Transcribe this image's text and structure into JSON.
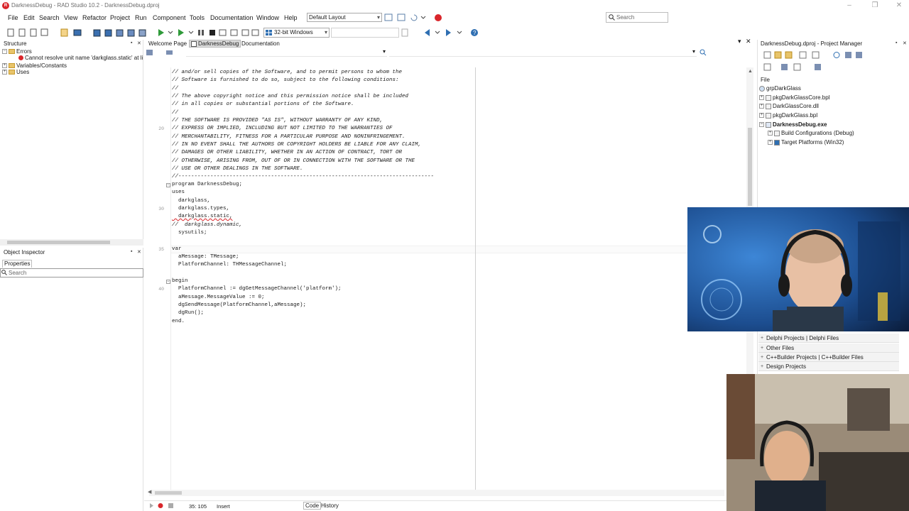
{
  "window": {
    "title": "DarknessDebug - RAD Studio 10.2 - DarknessDebug.dproj",
    "app_icon": "rad-studio-icon"
  },
  "menu": [
    "File",
    "Edit",
    "Search",
    "View",
    "Refactor",
    "Project",
    "Run",
    "Component",
    "Tools",
    "Documentation",
    "Window",
    "Help"
  ],
  "toolbar": {
    "layout": "Default Layout",
    "platform": "32-bit Windows"
  },
  "search": {
    "placeholder": "Search"
  },
  "structure": {
    "title": "Structure",
    "items": {
      "errors": "Errors",
      "error_message": "Cannot resolve unit name 'darkglass.static' at li",
      "vars": "Variables/Constants",
      "uses": "Uses"
    }
  },
  "object_inspector": {
    "title": "Object Inspector",
    "tab": "Properties",
    "search": "Search"
  },
  "tabs": [
    "Welcome Page",
    "DarknessDebug",
    "Documentation"
  ],
  "code": {
    "lines": [
      "// and/or sell copies of the Software, and to permit persons to whom the",
      "// Software is furnished to do so, subject to the following conditions:",
      "//",
      "// The above copyright notice and this permission notice shall be included",
      "// in all copies or substantial portions of the Software.",
      "//",
      "// THE SOFTWARE IS PROVIDED \"AS IS\", WITHOUT WARRANTY OF ANY KIND,",
      "// EXPRESS OR IMPLIED, INCLUDING BUT NOT LIMITED TO THE WARRANTIES OF",
      "// MERCHANTABILITY, FITNESS FOR A PARTICULAR PURPOSE AND NONINFRINGEMENT.",
      "// IN NO EVENT SHALL THE AUTHORS OR COPYRIGHT HOLDERS BE LIABLE FOR ANY CLAIM,",
      "// DAMAGES OR OTHER LIABILITY, WHETHER IN AN ACTION OF CONTRACT, TORT OR",
      "// OTHERWISE, ARISING FROM, OUT OF OR IN CONNECTION WITH THE SOFTWARE OR THE",
      "// USE OR OTHER DEALINGS IN THE SOFTWARE.",
      "//--------------------------------------------------------------------------------",
      "program DarknessDebug;",
      "uses",
      "  darkglass,",
      "  darkglass.types,",
      "  darkglass.static,",
      "//  darkglass.dynamic,",
      "  sysutils;",
      "",
      "var",
      "  aMessage: TMessage;",
      "  PlatformChannel: THMessageChannel;",
      "",
      "begin",
      "  PlatformChannel := dgGetMessageChannel('platform');",
      "  aMessage.MessageValue := 0;",
      "  dgSendMessage(PlatformChannel,aMessage);",
      "  dgRun();",
      "end."
    ],
    "line_numbers": [
      "20",
      "30",
      "35",
      "40"
    ]
  },
  "status": {
    "position": "35: 105",
    "mode": "Insert",
    "tabs": [
      "Code",
      "History"
    ]
  },
  "project_manager": {
    "title": "DarknessDebug.dproj - Project Manager",
    "file_label": "File",
    "items": [
      "grpDarkGlass",
      "pkgDarkGlassCore.bpl",
      "DarkGlassCore.dll",
      "pkgDarkGlass.bpl",
      "DarknessDebug.exe",
      "Build Configurations (Debug)",
      "Target Platforms (Win32)"
    ],
    "categories": [
      "Delphi Projects | Delphi Files",
      "Other Files",
      "C++Builder Projects | C++Builder Files",
      "Design Projects"
    ]
  },
  "colors": {
    "accent": "#2f6fb2",
    "error": "#d9262b",
    "webcam_bg": "#1c4d8f"
  }
}
